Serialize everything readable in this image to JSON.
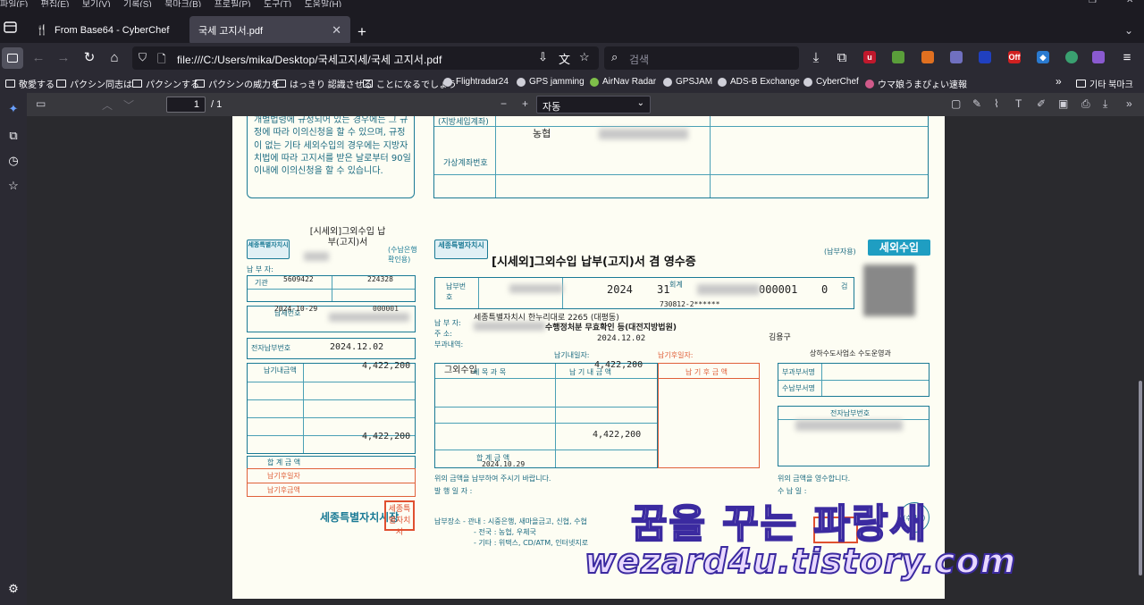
{
  "menu": [
    "파일(F)",
    "편집(E)",
    "보기(V)",
    "기록(S)",
    "북마크(B)",
    "프로필(P)",
    "도구(T)",
    "도움말(H)"
  ],
  "tabs": [
    {
      "title": "From Base64 - CyberChef",
      "active": false
    },
    {
      "title": "국세 고지서.pdf",
      "active": true
    }
  ],
  "address": {
    "url": "file:///C:/Users/mika/Desktop/국세고지세/국세 고지서.pdf"
  },
  "search": {
    "placeholder": "검색"
  },
  "bookmarks": [
    {
      "label": "敬愛する",
      "icon": "folder"
    },
    {
      "label": "パクシン同志は",
      "icon": "folder"
    },
    {
      "label": "パクシンする",
      "icon": "folder"
    },
    {
      "label": "パクシンの威力を",
      "icon": "folder"
    },
    {
      "label": "はっきり 認識させる",
      "icon": "folder"
    },
    {
      "label": "ことになるでしょう",
      "icon": "folder"
    },
    {
      "label": "Flightradar24",
      "icon": "globe"
    },
    {
      "label": "GPS jamming",
      "icon": "globe"
    },
    {
      "label": "AirNav Radar",
      "icon": "globe"
    },
    {
      "label": "GPSJAM",
      "icon": "globe"
    },
    {
      "label": "ADS-B Exchange",
      "icon": "globe"
    },
    {
      "label": "CyberChef",
      "icon": "globe"
    },
    {
      "label": "ウマ娘うまぴょい速報",
      "icon": "globe"
    },
    {
      "label": "기타 북마크",
      "icon": "folder"
    }
  ],
  "pdf_toolbar": {
    "page_current": "1",
    "page_total": "/ 1",
    "zoom": "자동"
  },
  "document": {
    "notice_text": "개별법령에 규정되어 있는 경우에는 그 규정에 따라 이의신청을 할 수 있으며, 규정이 없는 기타 세외수입의 경우에는 지방자치법에 따라 고지서를 받은 날로부터 90일 이내에 이의신청을 할 수 있습니다.",
    "bank_label": "(지방세입계좌)",
    "bank_name": "농협",
    "virtual_account_label": "가상계좌번호",
    "left_title": "[시세외]그외수입 납부(고지)서",
    "left_sub_label": "(수납은행 확인용)",
    "sejong_logo": "세종특별자치시",
    "payer_label": "납 부 자:",
    "agency_label": "기관",
    "agency_code": "5609422",
    "account_code": "224328",
    "receipt_label": "납세번호",
    "date_row": "2024-10-29",
    "serial": "000001",
    "e_payment_label": "전자납부번호",
    "e_payment_date": "2024.12.02",
    "deadline_label": "납기내금액",
    "amount": "4,422,200",
    "amount_total": "4,422,200",
    "total_label": "합 계 금 액",
    "after_deadline_label": "납기후일자",
    "after_amount_label": "납기후금액",
    "mayor": "세종특별자치시장",
    "right_title": "[시세외]그외수입 납부(고지)서 겸 영수증",
    "right_badge": "세외수입",
    "right_payer_copy": "(납부자용)",
    "payment_number_label": "납부번호",
    "year": "2024",
    "code_31": "31",
    "serial_right": "000001",
    "zero": "0",
    "check_label": "검",
    "acct_label": "회계",
    "id_partial": "730812-2******",
    "address_text": "세종특별자치시 한누리대로 2265 (대평동)",
    "address_label": "주 소:",
    "tax_category_label": "부과내역:",
    "department": "수행정처분 무효확인 등(대전지방법원)",
    "date_right": "2024.12.02",
    "district": "김용구",
    "department_right": "상하수도사업소 수도운영과",
    "deadline_right_label": "납기내일자:",
    "deadline_right_date": "2024.12.02",
    "after_deadline_right_label": "납기후일자:",
    "revenue_category": "그외수입",
    "items_header": "세 목 과 목",
    "deadline_amount_header": "납 기 내 금 액",
    "after_amount_header": "납 기 후 금 액",
    "amount_right": "4,422,200",
    "amount_right_total": "4,422,200",
    "total_right_label": "합 계 금 액",
    "issue_date": "2024.10.29",
    "request_text": "위의 금액을 납부하여 주시기 바랍니다.",
    "issue_date_label": "발 행 일 자 :",
    "dept_sign_label": "부과부서명",
    "receipt_sign_label": "수납부서명",
    "e_pay_right_label": "전자납부번호",
    "received_text": "위의 금액을 영수합니다.",
    "received_date_label": "수 납 일 :",
    "stamp_text": "(수납인)",
    "pay_places": "납부장소 - 관내 : 시중은행, 새마을금고, 신협, 수협",
    "pay_places2": "- 전국 : 농협, 우체국",
    "pay_places3": "- 기타 : 위택스, CD/ATM, 인터넷지로",
    "seal_text": "세종특별자치시"
  },
  "watermark": {
    "line1": "꿈을 꾸는 파랑새",
    "line2": "wezard4u.tistory.com"
  }
}
